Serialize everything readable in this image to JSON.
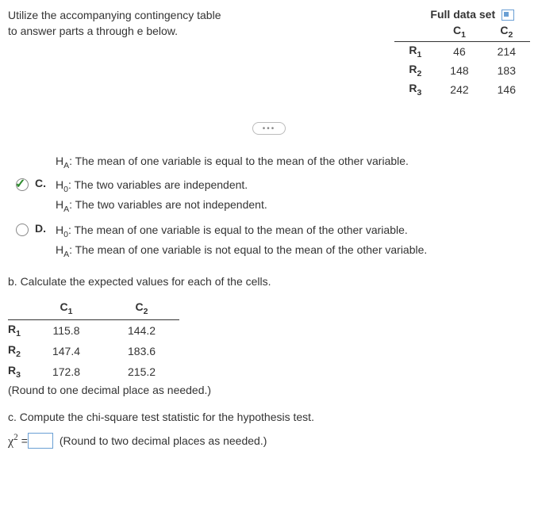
{
  "instruction": "Utilize the accompanying contingency table to answer parts a through e below.",
  "full_data_label": "Full data set",
  "table": {
    "cols": [
      "C",
      "C"
    ],
    "col_sub": [
      "1",
      "2"
    ],
    "rows": [
      {
        "label": "R",
        "sub": "1",
        "c1": "46",
        "c2": "214"
      },
      {
        "label": "R",
        "sub": "2",
        "c1": "148",
        "c2": "183"
      },
      {
        "label": "R",
        "sub": "3",
        "c1": "242",
        "c2": "146"
      }
    ]
  },
  "ellipsis": "•••",
  "partial_option_ha": "The mean of one variable is equal to the mean of the other variable.",
  "options": {
    "c": {
      "letter": "C.",
      "h0": "The two variables are independent.",
      "ha": "The two variables are not independent."
    },
    "d": {
      "letter": "D.",
      "h0": "The mean of one variable is equal to the mean of the other variable.",
      "ha": "The mean of one variable is not equal to the mean of the other variable."
    }
  },
  "labels": {
    "h0_prefix": "H",
    "h0_sub": "0",
    "ha_prefix": "H",
    "ha_sub": "A",
    "colon": ": "
  },
  "part_b": {
    "prompt": "b. Calculate the expected values for each of the cells.",
    "cols": [
      "C",
      "C"
    ],
    "col_sub": [
      "1",
      "2"
    ],
    "rows": [
      {
        "label": "R",
        "sub": "1",
        "c1": "115.8",
        "c2": "144.2"
      },
      {
        "label": "R",
        "sub": "2",
        "c1": "147.4",
        "c2": "183.6"
      },
      {
        "label": "R",
        "sub": "3",
        "c1": "172.8",
        "c2": "215.2"
      }
    ],
    "note": "(Round to one decimal place as needed.)"
  },
  "part_c": {
    "prompt": "c. Compute the chi-square test statistic for the hypothesis test.",
    "symbol": "χ",
    "exp": "2",
    "eq": " = ",
    "value": "",
    "note": "(Round to two decimal places as needed.)"
  }
}
